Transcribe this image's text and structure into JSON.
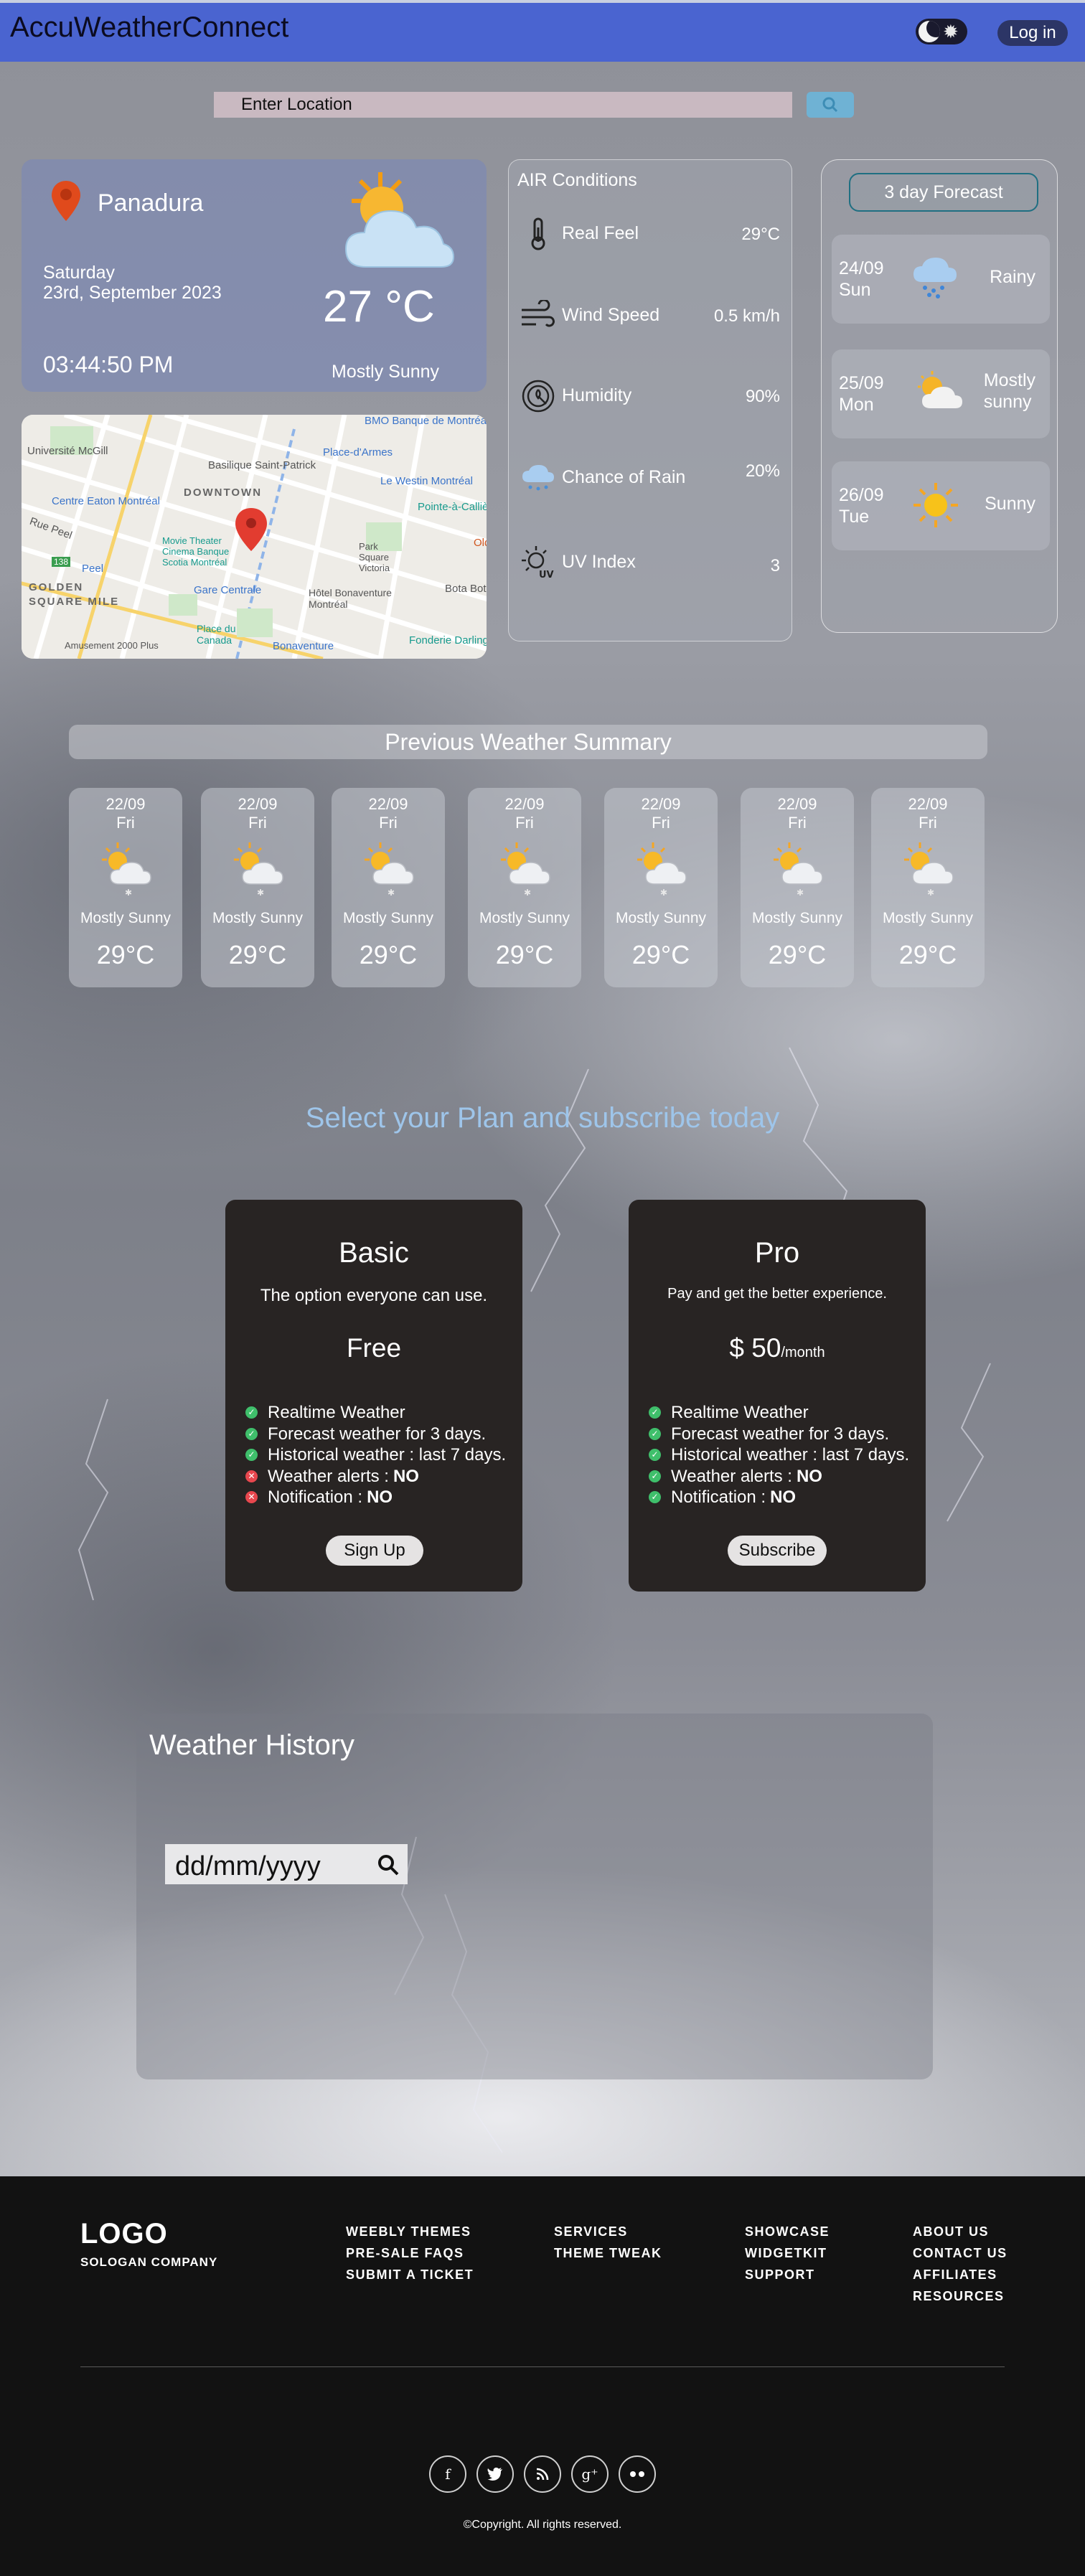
{
  "header": {
    "brand": "AccuWeatherConnect",
    "login_label": "Log in"
  },
  "search": {
    "placeholder": "Enter Location"
  },
  "current": {
    "location": "Panadura",
    "day": "Saturday",
    "date": "23rd, September 2023",
    "time": "03:44:50 PM",
    "temperature": "27 °C",
    "condition": "Mostly Sunny",
    "icon": "sun-behind-cloud-icon"
  },
  "map": {
    "labels": [
      "Université McGill",
      "Basilique Saint-Patrick",
      "BMO Banque de Montréal",
      "Place-d'Armes",
      "Le Westin Montréal",
      "Centre Eaton Montréal",
      "DOWNTOWN",
      "Pointe-à-Callière",
      "Rue Peel",
      "Movie Theater Cinema Banque Scotia Montréal",
      "Park Square Victoria",
      "GOLDEN",
      "SQUARE MILE",
      "Gare Centrale",
      "Hôtel Bonaventure Montréal",
      "Bota Bota",
      "Peel",
      "Place du Canada",
      "Fonderie Darling",
      "Amusement 2000 Plus",
      "Bonaventure",
      "Old",
      "138"
    ]
  },
  "air": {
    "title": "AIR Conditions",
    "rows": [
      {
        "label": "Real Feel",
        "value": "29°C",
        "icon": "thermometer-icon"
      },
      {
        "label": "Wind Speed",
        "value": "0.5 km/h",
        "icon": "wind-icon"
      },
      {
        "label": "Humidity",
        "value": "90%",
        "icon": "humidity-gauge-icon"
      },
      {
        "label": "Chance of Rain",
        "value": "20%",
        "icon": "rain-cloud-icon"
      },
      {
        "label": "UV Index",
        "value": "3",
        "icon": "uv-index-icon"
      }
    ]
  },
  "forecast": {
    "button_label": "3 day Forecast",
    "days": [
      {
        "date": "24/09",
        "weekday": "Sun",
        "condition": "Rainy",
        "condition_line2": "",
        "icon": "rain-cloud-icon"
      },
      {
        "date": "25/09",
        "weekday": "Mon",
        "condition": "Mostly",
        "condition_line2": "sunny",
        "icon": "sun-behind-cloud-icon"
      },
      {
        "date": "26/09",
        "weekday": "Tue",
        "condition": "Sunny",
        "condition_line2": "",
        "icon": "sun-icon"
      }
    ]
  },
  "previous": {
    "title": "Previous Weather Summary",
    "days": [
      {
        "date": "22/09",
        "weekday": "Fri",
        "condition": "Mostly Sunny",
        "temp": "29°C"
      },
      {
        "date": "22/09",
        "weekday": "Fri",
        "condition": "Mostly Sunny",
        "temp": "29°C"
      },
      {
        "date": "22/09",
        "weekday": "Fri",
        "condition": "Mostly Sunny",
        "temp": "29°C"
      },
      {
        "date": "22/09",
        "weekday": "Fri",
        "condition": "Mostly Sunny",
        "temp": "29°C"
      },
      {
        "date": "22/09",
        "weekday": "Fri",
        "condition": "Mostly Sunny",
        "temp": "29°C"
      },
      {
        "date": "22/09",
        "weekday": "Fri",
        "condition": "Mostly Sunny",
        "temp": "29°C"
      },
      {
        "date": "22/09",
        "weekday": "Fri",
        "condition": "Mostly Sunny",
        "temp": "29°C"
      }
    ]
  },
  "plans": {
    "title": "Select your Plan and subscribe today",
    "basic": {
      "name": "Basic",
      "description": "The option everyone can use.",
      "price": "Free",
      "features": [
        {
          "text": "Realtime Weather",
          "suffix": "",
          "included": true
        },
        {
          "text": "Forecast weather for 3 days.",
          "suffix": "",
          "included": true
        },
        {
          "text": "Historical weather : last 7 days.",
          "suffix": "",
          "included": true
        },
        {
          "text": "Weather alerts :",
          "suffix": "NO",
          "included": false
        },
        {
          "text": "Notification :",
          "suffix": "NO",
          "included": false
        }
      ],
      "button": "Sign Up"
    },
    "pro": {
      "name": "Pro",
      "description": "Pay and get the better experience.",
      "price": "$ 50",
      "price_unit": "/month",
      "features": [
        {
          "text": "Realtime Weather",
          "suffix": "",
          "included": true
        },
        {
          "text": "Forecast weather for 3 days.",
          "suffix": "",
          "included": true
        },
        {
          "text": "Historical weather : last 7 days.",
          "suffix": "",
          "included": true
        },
        {
          "text": "Weather alerts :",
          "suffix": "NO",
          "included": true
        },
        {
          "text": "Notification :",
          "suffix": "NO",
          "included": true
        }
      ],
      "button": "Subscribe"
    }
  },
  "history": {
    "title": "Weather History",
    "date_placeholder": "dd/mm/yyyy"
  },
  "footer": {
    "logo": "LOGO",
    "slogan": "SOLOGAN COMPANY",
    "columns": [
      [
        "WEEBLY THEMES",
        "PRE-SALE FAQS",
        "SUBMIT A TICKET"
      ],
      [
        "SERVICES",
        "THEME TWEAK"
      ],
      [
        "SHOWCASE",
        "WIDGETKIT",
        "SUPPORT"
      ],
      [
        "ABOUT US",
        "CONTACT US",
        "AFFILIATES",
        "RESOURCES"
      ]
    ],
    "social": [
      {
        "glyph": "f",
        "icon": "facebook-icon"
      },
      {
        "glyph": "",
        "icon": "twitter-icon"
      },
      {
        "glyph": "",
        "icon": "rss-icon"
      },
      {
        "glyph": "g⁺",
        "icon": "google-plus-icon"
      },
      {
        "glyph": "",
        "icon": "flickr-icon"
      }
    ],
    "copyright": "©Copyright. All rights reserved."
  },
  "colors": {
    "header": "#4a64d0",
    "plan_card": "#282423",
    "plans_title": "#9ec5ea",
    "check": "#3fbf6b",
    "cross": "#e8474e",
    "footer": "#121212"
  }
}
